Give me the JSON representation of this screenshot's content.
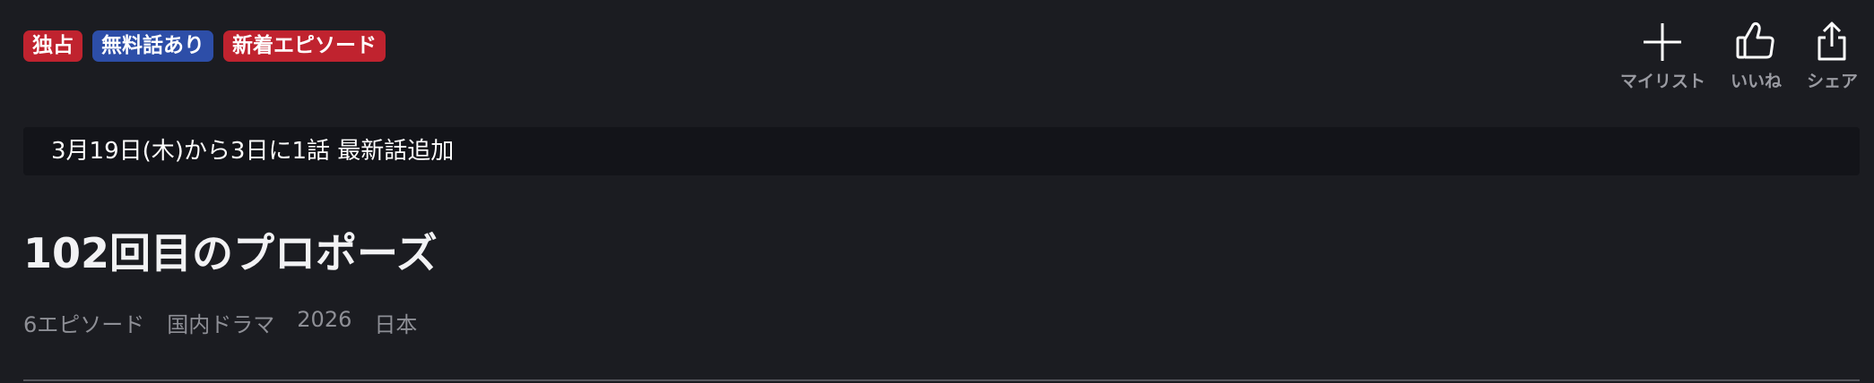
{
  "badges": [
    {
      "label": "独占",
      "color": "#c0232f"
    },
    {
      "label": "無料話あり",
      "color": "#2d4ea8"
    },
    {
      "label": "新着エピソード",
      "color": "#c0232f"
    }
  ],
  "actions": {
    "mylist_label": "マイリスト",
    "like_label": "いいね",
    "share_label": "シェア",
    "mylist_icon": "plus-icon",
    "like_icon": "thumbs-up-icon",
    "share_icon": "share-icon"
  },
  "notice": {
    "text": "3月19日(木)から3日に1話 最新話追加"
  },
  "title": "102回目のプロポーズ",
  "meta": {
    "episodes": "6エピソード",
    "genre": "国内ドラマ",
    "year": "2026",
    "country": "日本"
  },
  "colors": {
    "background": "#1b1c21",
    "notice_background": "#131419",
    "badge_red": "#c0232f",
    "badge_blue": "#2d4ea8",
    "muted_text": "#8e8f96"
  }
}
